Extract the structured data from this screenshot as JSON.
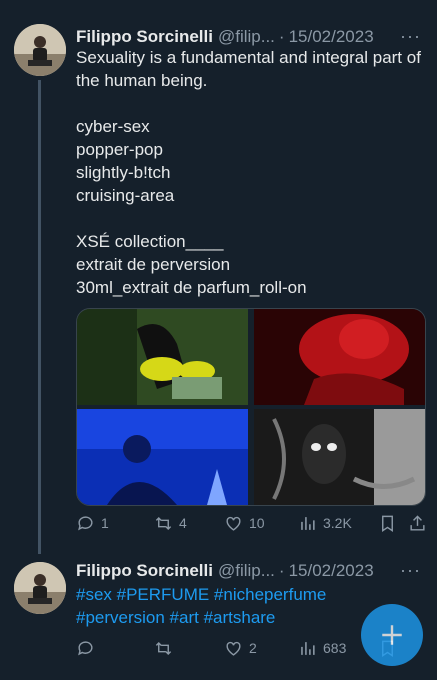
{
  "tweets": [
    {
      "author_name": "Filippo Sorcinelli",
      "handle": "@filip...",
      "separator": "·",
      "date": "15/02/2023",
      "more": "···",
      "text": "Sexuality is a fundamental and integral part of the human being.\n\ncyber-sex\npopper-pop\nslightly-b!tch\ncruising-area\n\nXSÉ collection____\nextrait de perversion\n30ml_extrait de parfum_roll-on",
      "actions": {
        "replies": "1",
        "retweets": "4",
        "likes": "10",
        "views": "3.2K"
      }
    },
    {
      "author_name": "Filippo Sorcinelli",
      "handle": "@filip...",
      "separator": "·",
      "date": "15/02/2023",
      "more": "···",
      "hashtags": "#sex #PERFUME #nicheperfume\n#perversion #art #artshare",
      "actions": {
        "replies": "",
        "retweets": "",
        "likes": "2",
        "views": "683"
      }
    }
  ],
  "icons": [
    "reply-icon",
    "retweet-icon",
    "like-icon",
    "views-icon",
    "bookmark-icon",
    "share-icon",
    "more-icon",
    "compose-plus-icon"
  ],
  "colors": {
    "background": "#15202b",
    "accent": "#1d9bf0",
    "muted": "#8b98a5",
    "text": "#e7e9ea"
  }
}
